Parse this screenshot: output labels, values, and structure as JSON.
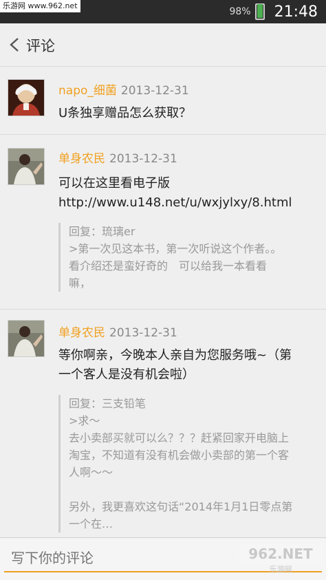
{
  "status_bar": {
    "watermark": "乐游网 www.962.net",
    "battery_percent": "98%",
    "battery_level": 0.98,
    "time": "21:48",
    "battery_color": "#4caf50"
  },
  "header": {
    "back_icon": "chevron-left-icon",
    "title": "评论"
  },
  "comments": [
    {
      "username": "napo_细菌",
      "date": "2013-12-31",
      "text_lines": [
        "U条独享赠品怎么获取？"
      ]
    },
    {
      "username": "单身农民",
      "date": "2013-12-31",
      "text_lines": [
        "可以在这里看电子版",
        "http://www.u148.net/u/wxjylxy/8.html"
      ],
      "quote_lines": [
        "回复：琉璃er",
        ">第一次见这本书，第一次听说这个作者。。",
        "  看介绍还是蛮好奇的　可以给我一本看看",
        "嘛，"
      ]
    },
    {
      "username": "单身农民",
      "date": "2013-12-31",
      "text_lines": [
        "等你啊亲，今晚本人亲自为您服务哦~（第",
        "一个客人是没有机会啦）"
      ],
      "quote_lines": [
        "回复：三支铅笔",
        ">求～",
        "去小卖部买就可以么？？？赶紧回家开电脑上",
        "淘宝，不知道有没有机会做小卖部的第一个客",
        "人啊～～",
        "",
        "另外，我更喜欢这句话“2014年1月1日零点第",
        "一个在…"
      ]
    }
  ],
  "input": {
    "placeholder": "写下你的评论"
  },
  "watermark_logo": {
    "brand": "962.NET",
    "sub": "乐游网"
  },
  "colors": {
    "accent": "#f0a020",
    "background": "#efefef"
  }
}
